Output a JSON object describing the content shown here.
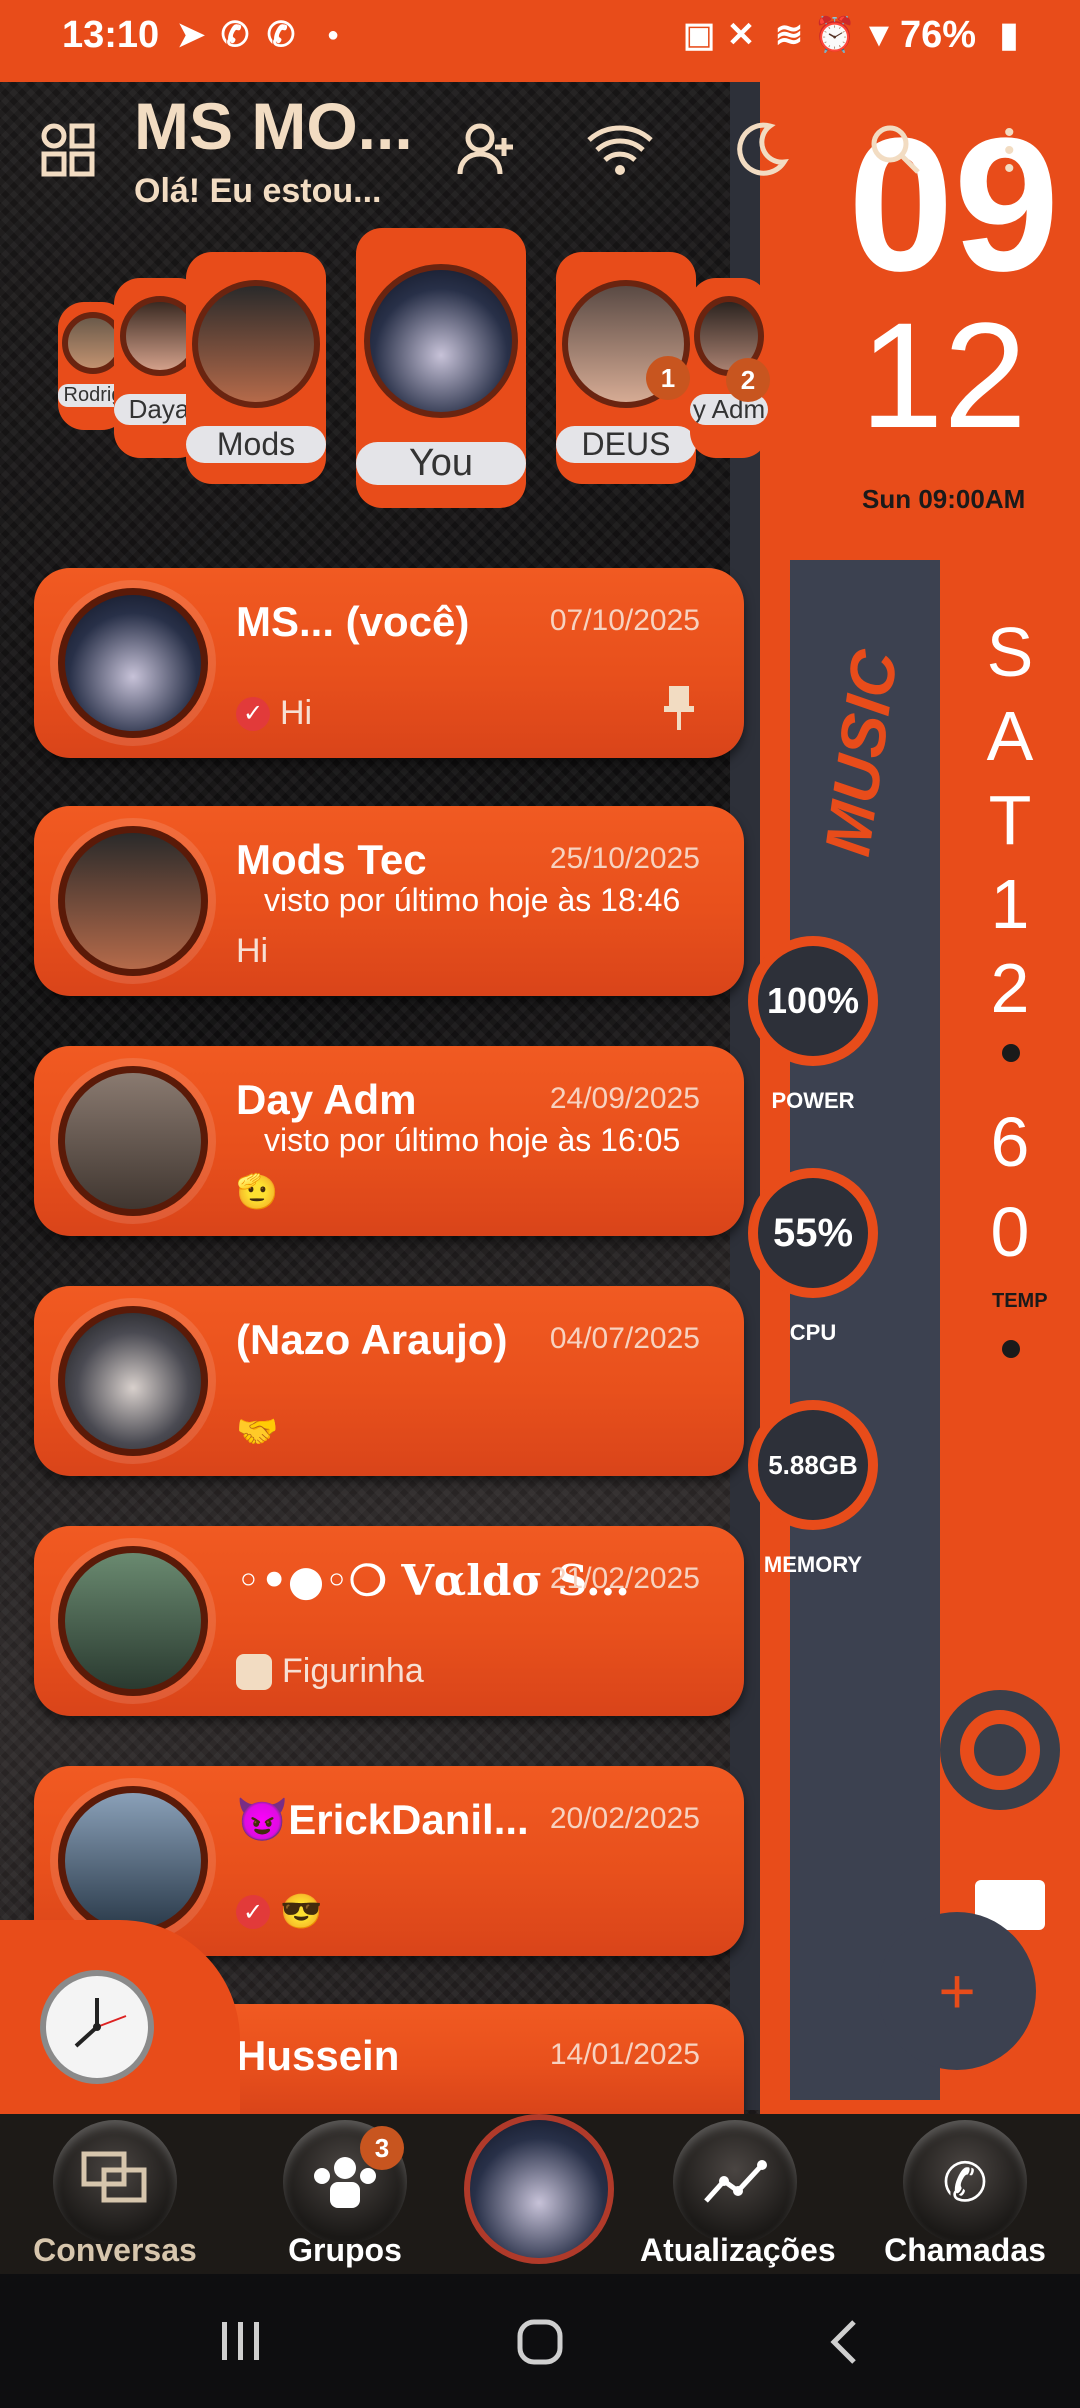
{
  "status_bar": {
    "time": "13:10",
    "battery": "76%"
  },
  "header": {
    "title": "MS MO...",
    "status": "Olá! Eu estou..."
  },
  "widget": {
    "hour": "09",
    "minute": "12",
    "date": "Sun 09:00AM",
    "music": "MUSIC",
    "day_letters": [
      "S",
      "A",
      "T",
      "1",
      "2"
    ],
    "temp_digits": [
      "6",
      "0"
    ],
    "temp_label": "TEMP",
    "gauges": [
      {
        "value": "100%",
        "label": "POWER"
      },
      {
        "value": "55%",
        "label": "CPU"
      },
      {
        "value": "5.88GB",
        "label": "MEMORY"
      }
    ]
  },
  "stories": [
    {
      "label": "Rodrig"
    },
    {
      "label": "Daya"
    },
    {
      "label": "Mods"
    },
    {
      "label": "You"
    },
    {
      "label": "DEUS",
      "badge": "1"
    },
    {
      "label": "y Adm",
      "badge": "2"
    }
  ],
  "chats": [
    {
      "name": "MS... (você)",
      "date": "07/10/2025",
      "message": "Hi",
      "check": true,
      "pinned": true
    },
    {
      "name": "Mods Tec",
      "date": "25/10/2025",
      "sub": "visto por último hoje às 18:46",
      "message": "Hi"
    },
    {
      "name": "Day Adm",
      "date": "24/09/2025",
      "sub": "visto por último hoje às 16:05",
      "message": "🫡"
    },
    {
      "name": "(Nazo Araujo)",
      "date": "04/07/2025",
      "message": "🤝"
    },
    {
      "name": "◦•●◦❍ Vαldσ S...",
      "date": "21/02/2025",
      "message": "Figurinha",
      "sticker": true
    },
    {
      "name": "😈ErickDanil...",
      "date": "20/02/2025",
      "message": "😎",
      "check": true
    },
    {
      "name": "Hussein",
      "date": "14/01/2025"
    }
  ],
  "nav": {
    "conversas": "Conversas",
    "grupos": "Grupos",
    "grupos_badge": "3",
    "atualizacoes": "Atualizações",
    "chamadas": "Chamadas"
  }
}
